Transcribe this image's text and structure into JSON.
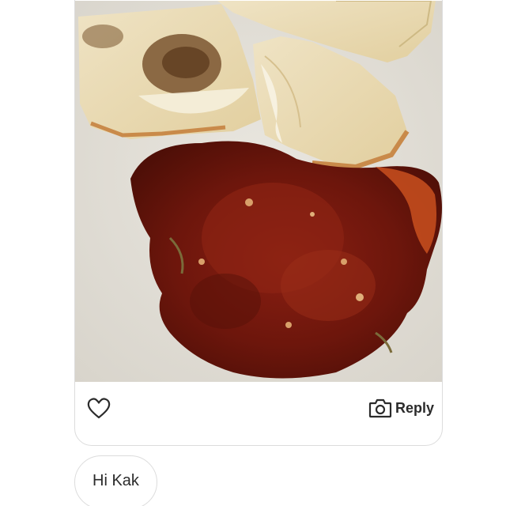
{
  "post": {
    "image_icon": "food-photo-murtabak-with-sambal",
    "reply_label": "Reply"
  },
  "icons": {
    "like": "heart-icon",
    "camera": "camera-icon"
  },
  "message": {
    "text": "Hi Kak"
  },
  "colors": {
    "text": "#2b2b2b",
    "border": "#dcdcdc",
    "background": "#ffffff"
  }
}
